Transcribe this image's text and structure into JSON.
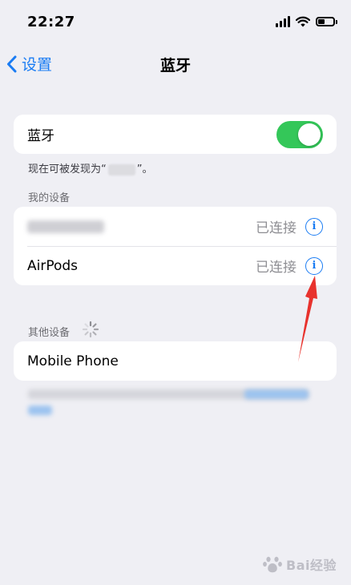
{
  "status_bar": {
    "time": "22:27",
    "icons": [
      "signal-icon",
      "wifi-icon",
      "battery-icon"
    ]
  },
  "nav": {
    "back_label": "设置",
    "title": "蓝牙"
  },
  "bluetooth": {
    "label": "蓝牙",
    "enabled": true,
    "discoverable_prefix": "现在可被发现为“",
    "discoverable_suffix": "”。"
  },
  "my_devices": {
    "header": "我的设备",
    "items": [
      {
        "name": "",
        "status": "已连接"
      },
      {
        "name": "AirPods",
        "status": "已连接"
      }
    ]
  },
  "other_devices": {
    "header": "其他设备",
    "items": [
      {
        "name": "Mobile Phone"
      }
    ]
  },
  "watermark": {
    "text": "Bai经验"
  },
  "colors": {
    "accent": "#1a7cf3",
    "toggle_on": "#34c759",
    "background": "#efeff4",
    "annotation_arrow": "#e8322d"
  }
}
